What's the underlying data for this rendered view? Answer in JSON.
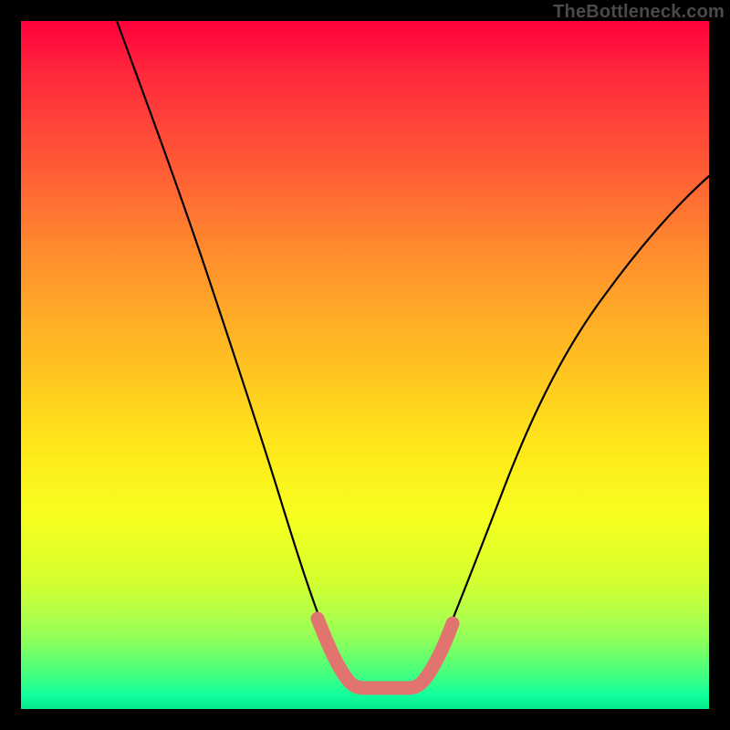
{
  "watermark": "TheBottleneck.com",
  "chart_data": {
    "type": "line",
    "title": "",
    "xlabel": "",
    "ylabel": "",
    "xlim": [
      0,
      100
    ],
    "ylim": [
      0,
      100
    ],
    "grid": false,
    "legend": false,
    "series": [
      {
        "name": "black-curve",
        "color": "#000000",
        "x": [
          14,
          18,
          22,
          26,
          30,
          34,
          37,
          40,
          42,
          44,
          46,
          48,
          50,
          52,
          54,
          56,
          58,
          60,
          62,
          66,
          70,
          74,
          78,
          82,
          86,
          90,
          94,
          98
        ],
        "y": [
          100,
          90,
          80,
          70,
          60,
          50,
          42,
          34,
          27,
          21,
          16,
          11,
          8,
          6,
          5,
          5,
          6,
          8,
          11,
          18,
          25,
          32,
          39,
          45,
          51,
          56,
          60,
          63
        ]
      },
      {
        "name": "pink-highlight",
        "color": "#e2746f",
        "x": [
          44,
          46,
          48,
          50,
          52,
          54,
          56,
          58
        ],
        "y": [
          16,
          8,
          5,
          4,
          4,
          4,
          5,
          9
        ]
      }
    ],
    "annotations": []
  }
}
